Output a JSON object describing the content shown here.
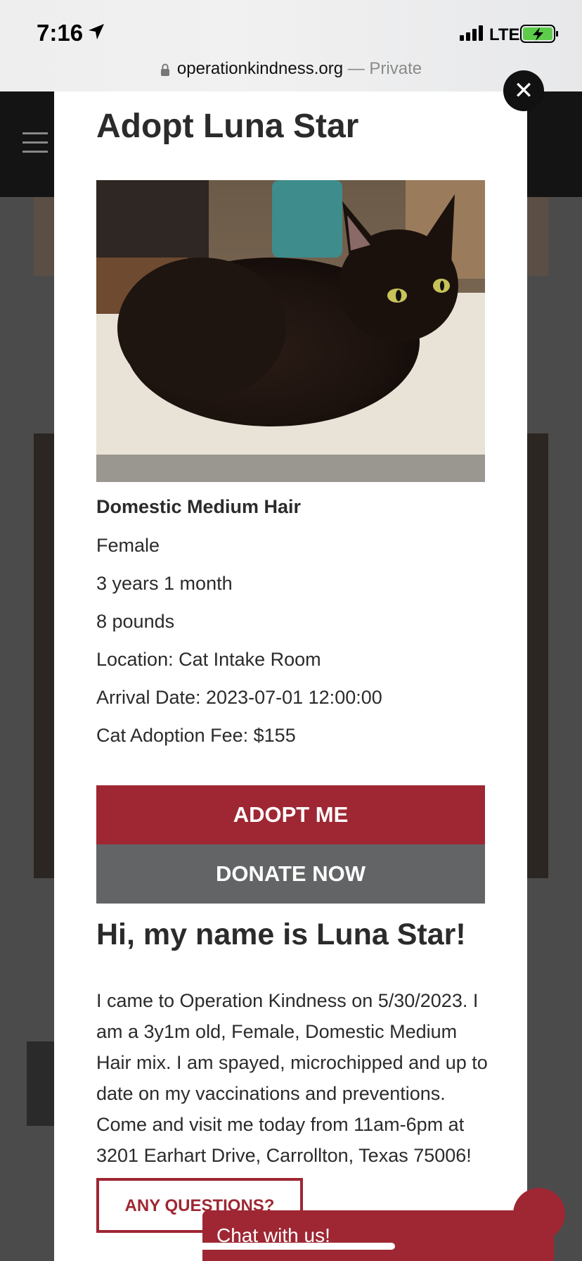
{
  "status_bar": {
    "time": "7:16",
    "network": "LTE"
  },
  "browser": {
    "domain": "operationkindness.org",
    "privacy_note": "— Private"
  },
  "modal": {
    "close_symbol": "✕",
    "title": "Adopt Luna Star",
    "breed": "Domestic Medium Hair",
    "details": [
      "Female",
      "3 years 1 month",
      "8 pounds",
      "Location: Cat Intake Room",
      "Arrival Date: 2023-07-01 12:00:00",
      "Cat Adoption Fee: $155"
    ],
    "adopt_label": "ADOPT ME",
    "donate_label": "DONATE NOW",
    "greeting": "Hi, my name is Luna Star!",
    "bio": "I came to Operation Kindness on 5/30/2023. I am a 3y1m old, Female, Domestic Medium Hair mix. I am spayed, microchipped and up to date on my vaccinations and preventions. Come and visit me today from 11am-6pm at 3201 Earhart Drive, Carrollton, Texas 75006!",
    "questions_label": "ANY QUESTIONS?"
  },
  "chat": {
    "label": "Chat with us!"
  },
  "colors": {
    "brand_red": "#9e2733",
    "donate_gray": "#636466",
    "text_dark": "#2b2b2b"
  }
}
